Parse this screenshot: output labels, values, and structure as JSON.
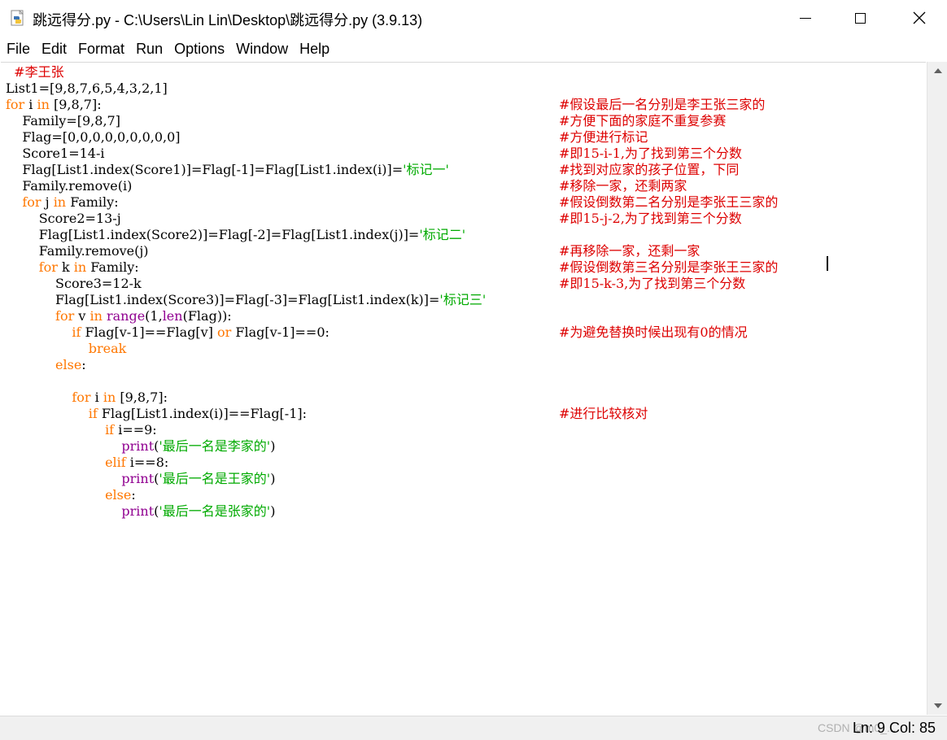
{
  "window": {
    "title": "跳远得分.py - C:\\Users\\Lin Lin\\Desktop\\跳远得分.py (3.9.13)"
  },
  "menu": [
    "File",
    "Edit",
    "Format",
    "Run",
    "Options",
    "Window",
    "Help"
  ],
  "code": {
    "lines": [
      [
        {
          "t": "  "
        },
        {
          "t": "#李王张",
          "c": "cm"
        }
      ],
      [
        {
          "t": "List1=[9,8,7,6,5,4,3,2,1]"
        }
      ],
      [
        {
          "t": "for",
          "c": "kw"
        },
        {
          "t": " i "
        },
        {
          "t": "in",
          "c": "kw"
        },
        {
          "t": " [9,8,7]:"
        }
      ],
      [
        {
          "t": "    Family=[9,8,7]"
        }
      ],
      [
        {
          "t": "    Flag=[0,0,0,0,0,0,0,0,0]"
        }
      ],
      [
        {
          "t": "    Score1=14-i"
        }
      ],
      [
        {
          "t": "    Flag[List1.index(Score1)]=Flag[-1]=Flag[List1.index(i)]="
        },
        {
          "t": "'标记一'",
          "c": "str"
        }
      ],
      [
        {
          "t": "    Family.remove(i)"
        }
      ],
      [
        {
          "t": "    "
        },
        {
          "t": "for",
          "c": "kw"
        },
        {
          "t": " j "
        },
        {
          "t": "in",
          "c": "kw"
        },
        {
          "t": " Family:"
        }
      ],
      [
        {
          "t": "        Score2=13-j"
        }
      ],
      [
        {
          "t": "        Flag[List1.index(Score2)]=Flag[-2]=Flag[List1.index(j)]="
        },
        {
          "t": "'标记二'",
          "c": "str"
        }
      ],
      [
        {
          "t": "        Family.remove(j)"
        }
      ],
      [
        {
          "t": "        "
        },
        {
          "t": "for",
          "c": "kw"
        },
        {
          "t": " k "
        },
        {
          "t": "in",
          "c": "kw"
        },
        {
          "t": " Family:"
        }
      ],
      [
        {
          "t": "            Score3=12-k"
        }
      ],
      [
        {
          "t": "            Flag[List1.index(Score3)]=Flag[-3]=Flag[List1.index(k)]="
        },
        {
          "t": "'标记三'",
          "c": "str"
        }
      ],
      [
        {
          "t": "            "
        },
        {
          "t": "for",
          "c": "kw"
        },
        {
          "t": " v "
        },
        {
          "t": "in",
          "c": "kw"
        },
        {
          "t": " "
        },
        {
          "t": "range",
          "c": "bi"
        },
        {
          "t": "(1,"
        },
        {
          "t": "len",
          "c": "bi"
        },
        {
          "t": "(Flag)):"
        }
      ],
      [
        {
          "t": "                "
        },
        {
          "t": "if",
          "c": "kw"
        },
        {
          "t": " Flag[v-1]==Flag[v] "
        },
        {
          "t": "or",
          "c": "kw"
        },
        {
          "t": " Flag[v-1]==0:"
        }
      ],
      [
        {
          "t": "                    "
        },
        {
          "t": "break",
          "c": "kw"
        }
      ],
      [
        {
          "t": "            "
        },
        {
          "t": "else",
          "c": "kw"
        },
        {
          "t": ":"
        }
      ],
      [
        {
          "t": ""
        }
      ],
      [
        {
          "t": "                "
        },
        {
          "t": "for",
          "c": "kw"
        },
        {
          "t": " i "
        },
        {
          "t": "in",
          "c": "kw"
        },
        {
          "t": " [9,8,7]:"
        }
      ],
      [
        {
          "t": "                    "
        },
        {
          "t": "if",
          "c": "kw"
        },
        {
          "t": " Flag[List1.index(i)]==Flag[-1]:"
        }
      ],
      [
        {
          "t": "                        "
        },
        {
          "t": "if",
          "c": "kw"
        },
        {
          "t": " i==9:"
        }
      ],
      [
        {
          "t": "                            "
        },
        {
          "t": "print",
          "c": "bi"
        },
        {
          "t": "("
        },
        {
          "t": "'最后一名是李家的'",
          "c": "str"
        },
        {
          "t": ")"
        }
      ],
      [
        {
          "t": "                        "
        },
        {
          "t": "elif",
          "c": "kw"
        },
        {
          "t": " i==8:"
        }
      ],
      [
        {
          "t": "                            "
        },
        {
          "t": "print",
          "c": "bi"
        },
        {
          "t": "("
        },
        {
          "t": "'最后一名是王家的'",
          "c": "str"
        },
        {
          "t": ")"
        }
      ],
      [
        {
          "t": "                        "
        },
        {
          "t": "else",
          "c": "kw"
        },
        {
          "t": ":"
        }
      ],
      [
        {
          "t": "                            "
        },
        {
          "t": "print",
          "c": "bi"
        },
        {
          "t": "("
        },
        {
          "t": "'最后一名是张家的'",
          "c": "str"
        },
        {
          "t": ")"
        }
      ]
    ],
    "comments": [
      null,
      null,
      "#假设最后一名分别是李王张三家的",
      "#方便下面的家庭不重复参赛",
      "#方便进行标记",
      "#即15-i-1,为了找到第三个分数",
      "#找到对应家的孩子位置，下同",
      "#移除一家，还剩两家",
      "#假设倒数第二名分别是李张王三家的",
      "#即15-j-2,为了找到第三个分数",
      null,
      "#再移除一家，还剩一家",
      "#假设倒数第三名分别是李张王三家的",
      "#即15-k-3,为了找到第三个分数",
      null,
      null,
      "#为避免替换时候出现有0的情况",
      null,
      null,
      null,
      null,
      "#进行比较核对",
      null,
      null,
      null,
      null,
      null,
      null
    ]
  },
  "status": {
    "position": "Ln: 9  Col: 85",
    "watermark": "CSDN @m0_..."
  },
  "colors": {
    "keyword": "#ff7700",
    "builtin": "#900090",
    "string": "#00aa00",
    "comment": "#dd0000"
  },
  "icons": {
    "app": "python-file-icon",
    "minimize": "minimize-icon",
    "maximize": "maximize-icon",
    "close": "close-icon",
    "scroll_up": "scroll-up-arrow-icon",
    "scroll_down": "scroll-down-arrow-icon"
  }
}
